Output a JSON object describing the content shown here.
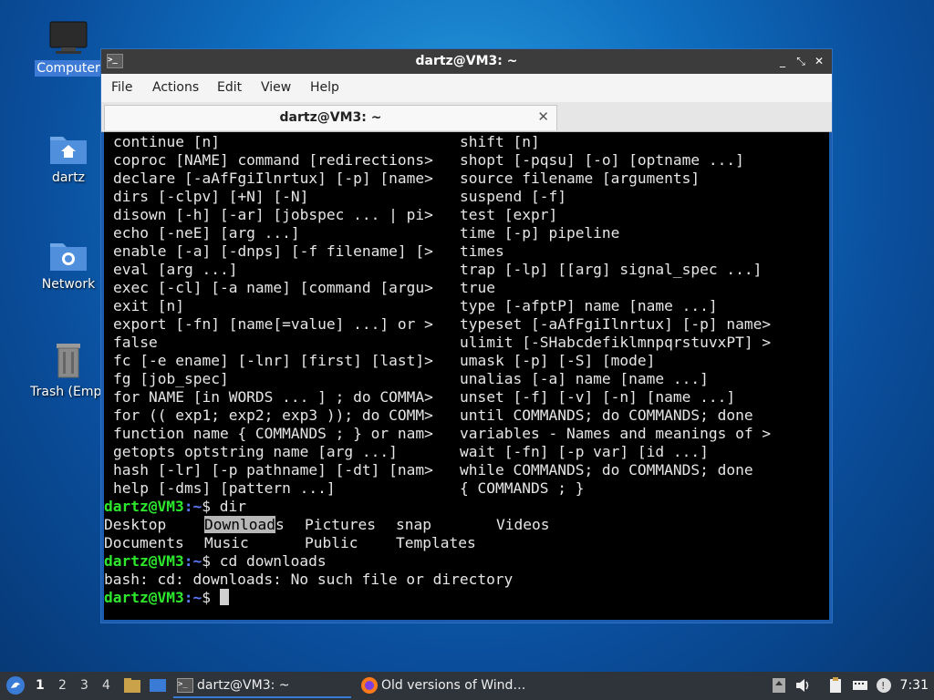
{
  "desktop": {
    "icons": [
      {
        "label": "Computer"
      },
      {
        "label": "dartz"
      },
      {
        "label": "Network"
      },
      {
        "label": "Trash (Empt"
      }
    ]
  },
  "window": {
    "title": "dartz@VM3: ~",
    "controls": {
      "minimize": "_",
      "maximize": "⤡",
      "close": "✕"
    },
    "menu": [
      "File",
      "Actions",
      "Edit",
      "View",
      "Help"
    ],
    "tab": {
      "title": "dartz@VM3: ~",
      "close": "✕"
    }
  },
  "terminal": {
    "help_rows": [
      [
        "continue [n]",
        "shift [n]"
      ],
      [
        "coproc [NAME] command [redirections>",
        "shopt [-pqsu] [-o] [optname ...]"
      ],
      [
        "declare [-aAfFgiIlnrtux] [-p] [name>",
        "source filename [arguments]"
      ],
      [
        "dirs [-clpv] [+N] [-N]",
        "suspend [-f]"
      ],
      [
        "disown [-h] [-ar] [jobspec ... | pi>",
        "test [expr]"
      ],
      [
        "echo [-neE] [arg ...]",
        "time [-p] pipeline"
      ],
      [
        "enable [-a] [-dnps] [-f filename] [>",
        "times"
      ],
      [
        "eval [arg ...]",
        "trap [-lp] [[arg] signal_spec ...]"
      ],
      [
        "exec [-cl] [-a name] [command [argu>",
        "true"
      ],
      [
        "exit [n]",
        "type [-afptP] name [name ...]"
      ],
      [
        "export [-fn] [name[=value] ...] or >",
        "typeset [-aAfFgiIlnrtux] [-p] name>"
      ],
      [
        "false",
        "ulimit [-SHabcdefiklmnpqrstuvxPT] >"
      ],
      [
        "fc [-e ename] [-lnr] [first] [last]>",
        "umask [-p] [-S] [mode]"
      ],
      [
        "fg [job_spec]",
        "unalias [-a] name [name ...]"
      ],
      [
        "for NAME [in WORDS ... ] ; do COMMA>",
        "unset [-f] [-v] [-n] [name ...]"
      ],
      [
        "for (( exp1; exp2; exp3 )); do COMM>",
        "until COMMANDS; do COMMANDS; done"
      ],
      [
        "function name { COMMANDS ; } or nam>",
        "variables - Names and meanings of >"
      ],
      [
        "getopts optstring name [arg ...]",
        "wait [-fn] [-p var] [id ...]"
      ],
      [
        "hash [-lr] [-p pathname] [-dt] [nam>",
        "while COMMANDS; do COMMANDS; done"
      ],
      [
        "help [-dms] [pattern ...]",
        "{ COMMANDS ; }"
      ]
    ],
    "prompt_user": "dartz@VM3",
    "prompt_path": ":~",
    "prompt_sign": "$ ",
    "cmd1": "dir",
    "dir_row1": {
      "a": "Desktop",
      "b_hl": "Download",
      "b_rest": "s",
      "c": "Pictures",
      "d": "snap",
      "e": "Videos"
    },
    "dir_row2": {
      "a": "Documents",
      "b": "Music",
      "c": "Public",
      "d": "Templates"
    },
    "cmd2": "cd downloads",
    "error": "bash: cd: downloads: No such file or directory"
  },
  "taskbar": {
    "workspaces": [
      "1",
      "2",
      "3",
      "4"
    ],
    "tasks": [
      {
        "label": "dartz@VM3: ~"
      },
      {
        "label": "Old versions of Wind…"
      }
    ],
    "clock": "7:31"
  },
  "colors": {
    "prompt_user": "#2ee82e",
    "prompt_path": "#5c7cff",
    "accent": "#3a7bd5"
  }
}
